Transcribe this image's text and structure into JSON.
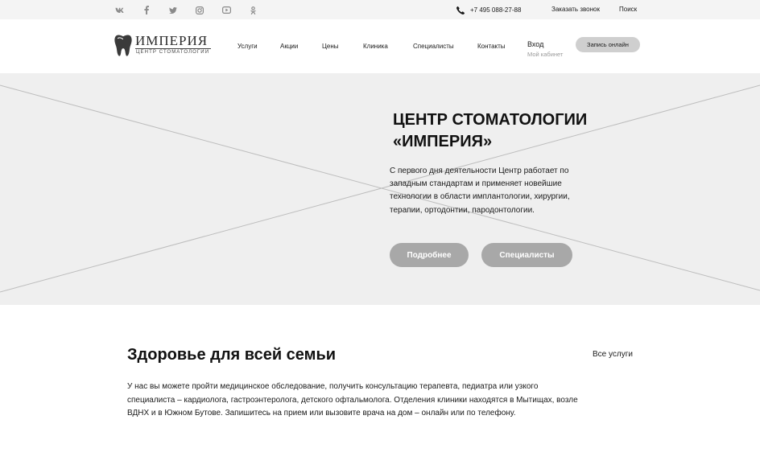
{
  "topbar": {
    "social": [
      {
        "icon": "vk-icon"
      },
      {
        "icon": "facebook-icon"
      },
      {
        "icon": "twitter-icon"
      },
      {
        "icon": "instagram-icon"
      },
      {
        "icon": "youtube-icon"
      },
      {
        "icon": "odnoklassniki-icon"
      }
    ],
    "phone_icon": "phone-icon",
    "phone": "+7 495 088-27-88",
    "callback_label": "Заказать звонок",
    "search_label": "Поиск"
  },
  "header": {
    "logo": {
      "icon": "tooth-icon",
      "title": "ИМПЕРИЯ",
      "subtitle": "ЦЕНТР СТОМАТОЛОГИИ"
    },
    "nav": [
      "Услуги",
      "Акции",
      "Цены",
      "Клиника",
      "Специалисты",
      "Контакты"
    ],
    "login": {
      "title": "Вход",
      "subtitle": "Мой кабинет"
    },
    "book_button": "Запись онлайн"
  },
  "hero": {
    "title_line1": "ЦЕНТР СТОМАТОЛОГИИ",
    "title_line2": "«ИМПЕРИЯ»",
    "text": "С первого дня деятельности Центр работает по западным стандартам и применяет новейшие технологии в области имплантологии, хирургии, терапии, ортодонтии, пародонтологии.",
    "buttons": {
      "more": "Подробнее",
      "specialists": "Специалисты"
    },
    "colors": {
      "background": "#efefef",
      "button": "#a8a8a8"
    }
  },
  "section": {
    "title": "Здоровье для всей семьи",
    "link": "Все услуги",
    "text": "У нас вы можете пройти медицинское обследование, получить консультацию терапевта, педиатра или узкого специалиста – кардиолога, гастроэнтеролога, детского офтальмолога. Отделения клиники находятся в Мытищах, возле ВДНХ и в Южном Бутове. Запишитесь на прием или вызовите врача на дом – онлайн или по телефону."
  }
}
